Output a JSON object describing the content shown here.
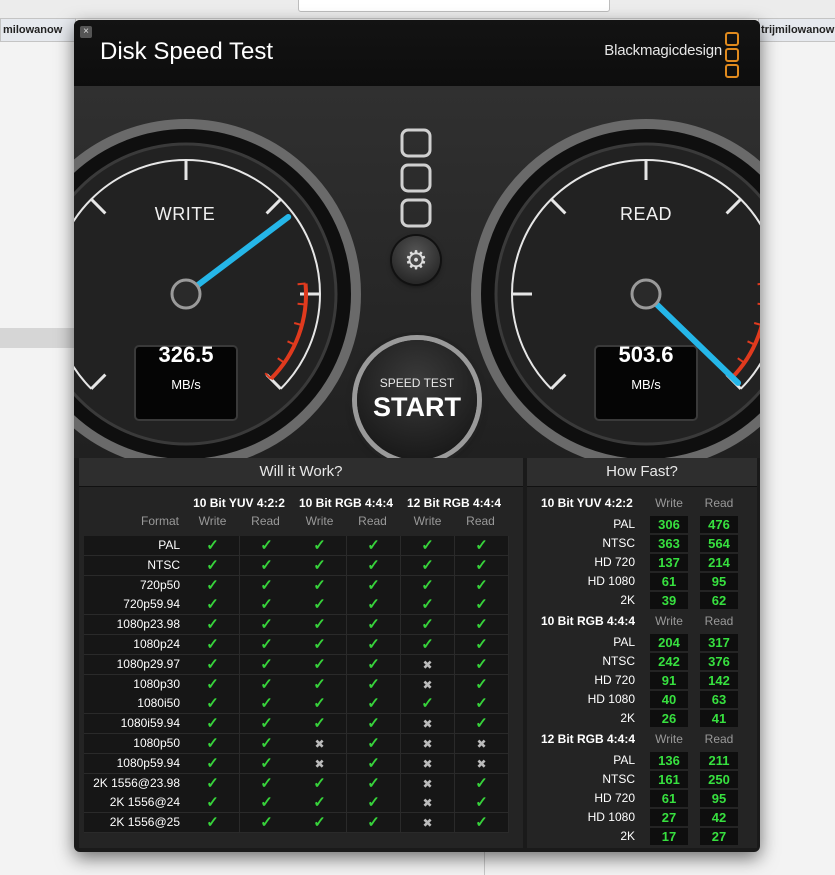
{
  "background": {
    "left_tab": "milowanow",
    "right_tab": "trijmilowanow"
  },
  "window": {
    "close_label": "×",
    "title": "Disk Speed Test",
    "brand": "Blackmagicdesign",
    "brand_color": "#e08a1e"
  },
  "gauges": {
    "write": {
      "label": "WRITE",
      "value": "326.5",
      "unit": "MB/s",
      "needle_color": "#25b6e8"
    },
    "read": {
      "label": "READ",
      "value": "503.6",
      "unit": "MB/s",
      "needle_color": "#25b6e8"
    },
    "danger_color": "#e03a1e"
  },
  "controls": {
    "settings_icon": "gear-icon",
    "start_small": "SPEED TEST",
    "start_big": "START"
  },
  "will_it_work": {
    "title": "Will it Work?",
    "format_label": "Format",
    "columns": [
      {
        "name": "10 Bit YUV 4:2:2",
        "write": "Write",
        "read": "Read"
      },
      {
        "name": "10 Bit RGB 4:4:4",
        "write": "Write",
        "read": "Read"
      },
      {
        "name": "12 Bit RGB 4:4:4",
        "write": "Write",
        "read": "Read"
      }
    ],
    "rows": [
      {
        "format": "PAL",
        "ok": [
          1,
          1,
          1,
          1,
          1,
          1
        ]
      },
      {
        "format": "NTSC",
        "ok": [
          1,
          1,
          1,
          1,
          1,
          1
        ]
      },
      {
        "format": "720p50",
        "ok": [
          1,
          1,
          1,
          1,
          1,
          1
        ]
      },
      {
        "format": "720p59.94",
        "ok": [
          1,
          1,
          1,
          1,
          1,
          1
        ]
      },
      {
        "format": "1080p23.98",
        "ok": [
          1,
          1,
          1,
          1,
          1,
          1
        ]
      },
      {
        "format": "1080p24",
        "ok": [
          1,
          1,
          1,
          1,
          1,
          1
        ]
      },
      {
        "format": "1080p29.97",
        "ok": [
          1,
          1,
          1,
          1,
          0,
          1
        ]
      },
      {
        "format": "1080p30",
        "ok": [
          1,
          1,
          1,
          1,
          0,
          1
        ]
      },
      {
        "format": "1080i50",
        "ok": [
          1,
          1,
          1,
          1,
          1,
          1
        ]
      },
      {
        "format": "1080i59.94",
        "ok": [
          1,
          1,
          1,
          1,
          0,
          1
        ]
      },
      {
        "format": "1080p50",
        "ok": [
          1,
          1,
          0,
          1,
          0,
          0
        ]
      },
      {
        "format": "1080p59.94",
        "ok": [
          1,
          1,
          0,
          1,
          0,
          0
        ]
      },
      {
        "format": "2K 1556@23.98",
        "ok": [
          1,
          1,
          1,
          1,
          0,
          1
        ]
      },
      {
        "format": "2K 1556@24",
        "ok": [
          1,
          1,
          1,
          1,
          0,
          1
        ]
      },
      {
        "format": "2K 1556@25",
        "ok": [
          1,
          1,
          1,
          1,
          0,
          1
        ]
      }
    ]
  },
  "how_fast": {
    "title": "How Fast?",
    "groups": [
      {
        "name": "10 Bit YUV 4:2:2",
        "write": "Write",
        "read": "Read",
        "rows": [
          {
            "label": "PAL",
            "w": "306",
            "r": "476"
          },
          {
            "label": "NTSC",
            "w": "363",
            "r": "564"
          },
          {
            "label": "HD 720",
            "w": "137",
            "r": "214"
          },
          {
            "label": "HD 1080",
            "w": "61",
            "r": "95"
          },
          {
            "label": "2K",
            "w": "39",
            "r": "62"
          }
        ]
      },
      {
        "name": "10 Bit RGB 4:4:4",
        "write": "Write",
        "read": "Read",
        "rows": [
          {
            "label": "PAL",
            "w": "204",
            "r": "317"
          },
          {
            "label": "NTSC",
            "w": "242",
            "r": "376"
          },
          {
            "label": "HD 720",
            "w": "91",
            "r": "142"
          },
          {
            "label": "HD 1080",
            "w": "40",
            "r": "63"
          },
          {
            "label": "2K",
            "w": "26",
            "r": "41"
          }
        ]
      },
      {
        "name": "12 Bit RGB 4:4:4",
        "write": "Write",
        "read": "Read",
        "rows": [
          {
            "label": "PAL",
            "w": "136",
            "r": "211"
          },
          {
            "label": "NTSC",
            "w": "161",
            "r": "250"
          },
          {
            "label": "HD 720",
            "w": "61",
            "r": "95"
          },
          {
            "label": "HD 1080",
            "w": "27",
            "r": "42"
          },
          {
            "label": "2K",
            "w": "17",
            "r": "27"
          }
        ]
      }
    ]
  }
}
